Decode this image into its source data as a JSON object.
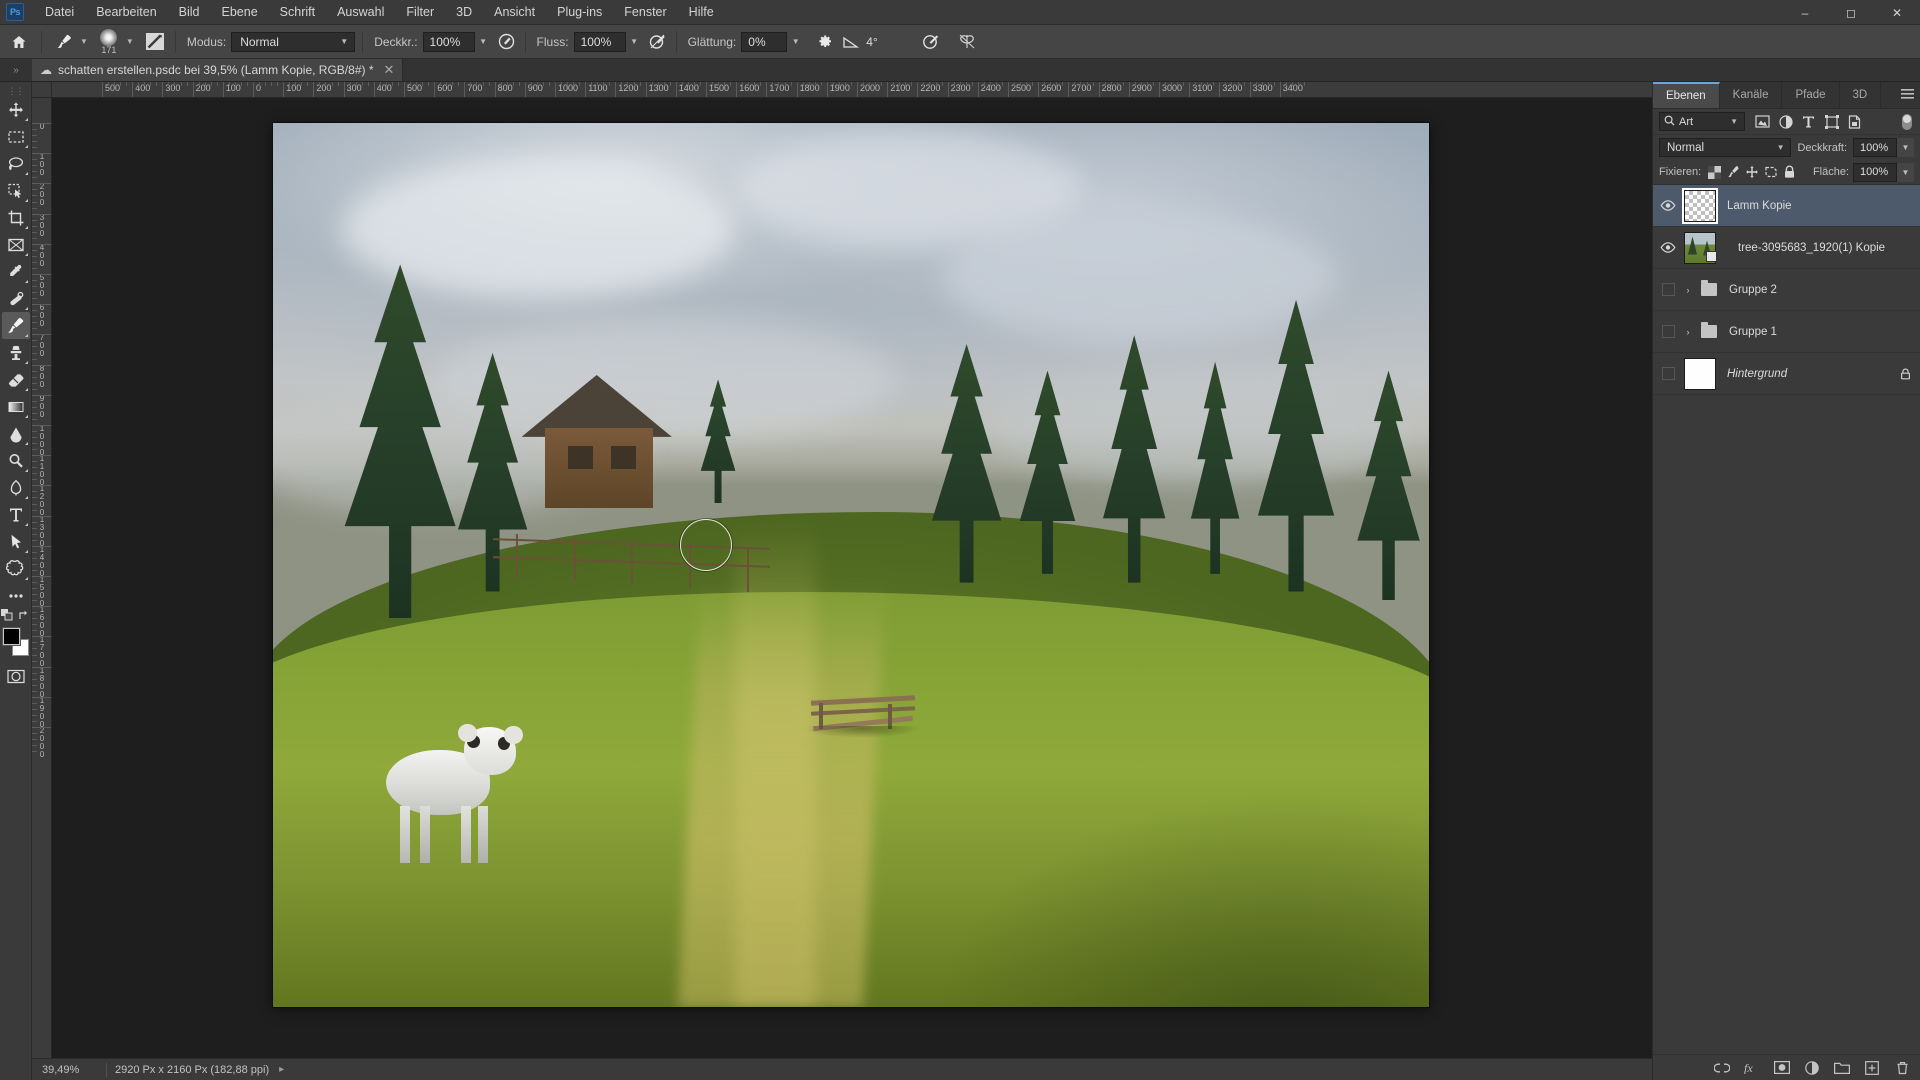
{
  "app": {
    "logo": "Ps"
  },
  "menu": {
    "items": [
      "Datei",
      "Bearbeiten",
      "Bild",
      "Ebene",
      "Schrift",
      "Auswahl",
      "Filter",
      "3D",
      "Ansicht",
      "Plug-ins",
      "Fenster",
      "Hilfe"
    ]
  },
  "window_controls": {
    "minimize": "minimize-icon",
    "maximize": "maximize-icon",
    "close": "close-icon"
  },
  "options_bar": {
    "home_icon": "home-icon",
    "brush_preset_icon": "brush-icon",
    "brush_size": "171",
    "brush_panel_icon": "brush-settings-icon",
    "mode_label": "Modus:",
    "mode_value": "Normal",
    "opacity_label": "Deckkr.:",
    "opacity_value": "100%",
    "pressure_opacity_icon": "pressure-opacity-icon",
    "flow_label": "Fluss:",
    "flow_value": "100%",
    "airbrush_icon": "airbrush-icon",
    "smoothing_label": "Glättung:",
    "smoothing_value": "0%",
    "smoothing_options_icon": "gear-icon",
    "angle_icon": "brush-angle-icon",
    "angle_value": "4°",
    "pressure_size_icon": "pressure-size-icon",
    "symmetry_icon": "symmetry-butterfly-icon"
  },
  "document_tab": {
    "cloud_icon": "cloud-document-icon",
    "title": "schatten erstellen.psdc bei 39,5% (Lamm Kopie, RGB/8#) *",
    "close_icon": "close-icon"
  },
  "toolbar": {
    "tools": [
      {
        "name": "move-tool",
        "icon": "move-icon",
        "active": false
      },
      {
        "name": "rectangular-marquee-tool",
        "icon": "marquee-icon",
        "active": false
      },
      {
        "name": "lasso-tool",
        "icon": "lasso-icon",
        "active": false
      },
      {
        "name": "quick-selection-tool",
        "icon": "quick-select-icon",
        "active": false
      },
      {
        "name": "crop-tool",
        "icon": "crop-icon",
        "active": false
      },
      {
        "name": "frame-tool",
        "icon": "frame-icon",
        "active": false
      },
      {
        "name": "eyedropper-tool",
        "icon": "eyedropper-icon",
        "active": false
      },
      {
        "name": "healing-brush-tool",
        "icon": "healing-brush-icon",
        "active": false
      },
      {
        "name": "brush-tool",
        "icon": "brush-icon",
        "active": true
      },
      {
        "name": "clone-stamp-tool",
        "icon": "clone-stamp-icon",
        "active": false
      },
      {
        "name": "eraser-tool",
        "icon": "eraser-icon",
        "active": false
      },
      {
        "name": "gradient-tool",
        "icon": "gradient-icon",
        "active": false
      },
      {
        "name": "blur-tool",
        "icon": "blur-drop-icon",
        "active": false
      },
      {
        "name": "dodge-tool",
        "icon": "dodge-icon",
        "active": false
      },
      {
        "name": "pen-tool",
        "icon": "pen-icon",
        "active": false
      },
      {
        "name": "type-tool",
        "icon": "type-icon",
        "active": false
      },
      {
        "name": "path-selection-tool",
        "icon": "path-select-arrow-icon",
        "active": false
      },
      {
        "name": "shape-tool",
        "icon": "custom-shape-icon",
        "active": false
      },
      {
        "name": "more-tools",
        "icon": "ellipsis-icon",
        "active": false
      }
    ],
    "quick_mask_icon": "quick-mask-icon",
    "foreground_color": "#000000",
    "background_color": "#ffffff"
  },
  "rulers": {
    "horizontal": [
      "500",
      "400",
      "300",
      "200",
      "100",
      "0",
      "100",
      "200",
      "300",
      "400",
      "500",
      "600",
      "700",
      "800",
      "900",
      "1000",
      "1100",
      "1200",
      "1300",
      "1400",
      "1500",
      "1600",
      "1700",
      "1800",
      "1900",
      "2000",
      "2100",
      "2200",
      "2300",
      "2400",
      "2500",
      "2600",
      "2700",
      "2800",
      "2900",
      "3000",
      "3100",
      "3200",
      "3300",
      "3400"
    ],
    "vertical": [
      "0",
      "100",
      "200",
      "300",
      "400",
      "500",
      "600",
      "700",
      "800",
      "900",
      "1000",
      "1100",
      "1200",
      "1300",
      "1400",
      "1500",
      "1600",
      "1700",
      "1800",
      "1900",
      "2000"
    ]
  },
  "canvas": {
    "brush_cursor": "brush-cursor-ring",
    "artwork_description": "alpine meadow with wooden cabin, spruce trees, bench and a lamb"
  },
  "status_bar": {
    "zoom": "39,49%",
    "doc_size": "2920 Px x 2160 Px (182,88 ppi)",
    "expand_icon": "chevron-right-icon"
  },
  "right_dock": {
    "tabs": [
      {
        "label": "Ebenen",
        "active": true
      },
      {
        "label": "Kanäle",
        "active": false
      },
      {
        "label": "Pfade",
        "active": false
      },
      {
        "label": "3D",
        "active": false
      }
    ],
    "panel_menu_icon": "panel-menu-icon",
    "filter": {
      "search_icon": "search-icon",
      "kind_value": "Art",
      "kind_caret": "chevron-down-icon",
      "icons": [
        "pixel-layer-filter-icon",
        "adjustment-layer-filter-icon",
        "type-layer-filter-icon",
        "shape-layer-filter-icon",
        "smart-object-filter-icon"
      ],
      "toggle": "filter-toggle-switch"
    },
    "blend": {
      "mode_value": "Normal",
      "mode_caret": "chevron-down-icon",
      "opacity_label": "Deckkraft:",
      "opacity_value": "100%"
    },
    "lock": {
      "label": "Fixieren:",
      "icons": [
        "lock-transparent-pixels-icon",
        "lock-image-pixels-icon",
        "lock-position-icon",
        "lock-artboard-nesting-icon",
        "lock-all-icon"
      ],
      "fill_label": "Fläche:",
      "fill_value": "100%"
    },
    "layers": [
      {
        "name": "Lamm Kopie",
        "visible": true,
        "selected": true,
        "thumb": "checker",
        "type": "layer",
        "locked": false,
        "italic": false
      },
      {
        "name": "tree-3095683_1920(1) Kopie",
        "visible": true,
        "selected": false,
        "thumb": "photo",
        "type": "layer",
        "locked": false,
        "italic": false
      },
      {
        "name": "Gruppe 2",
        "visible": false,
        "selected": false,
        "thumb": "folder",
        "type": "group",
        "locked": false,
        "italic": false
      },
      {
        "name": "Gruppe 1",
        "visible": false,
        "selected": false,
        "thumb": "folder",
        "type": "group",
        "locked": false,
        "italic": false
      },
      {
        "name": "Hintergrund",
        "visible": false,
        "selected": false,
        "thumb": "white",
        "type": "layer",
        "locked": true,
        "italic": true
      }
    ],
    "footer_icons": [
      "link-layers-icon",
      "layer-style-fx-icon",
      "add-layer-mask-icon",
      "new-adjustment-layer-icon",
      "new-group-icon",
      "new-layer-icon",
      "delete-layer-icon"
    ]
  },
  "colors": {
    "accent": "#6aa5e0",
    "panel_bg": "#3a3a3a",
    "selected_layer": "#4d5a6b",
    "canvas_bg": "#1e1e1e"
  }
}
